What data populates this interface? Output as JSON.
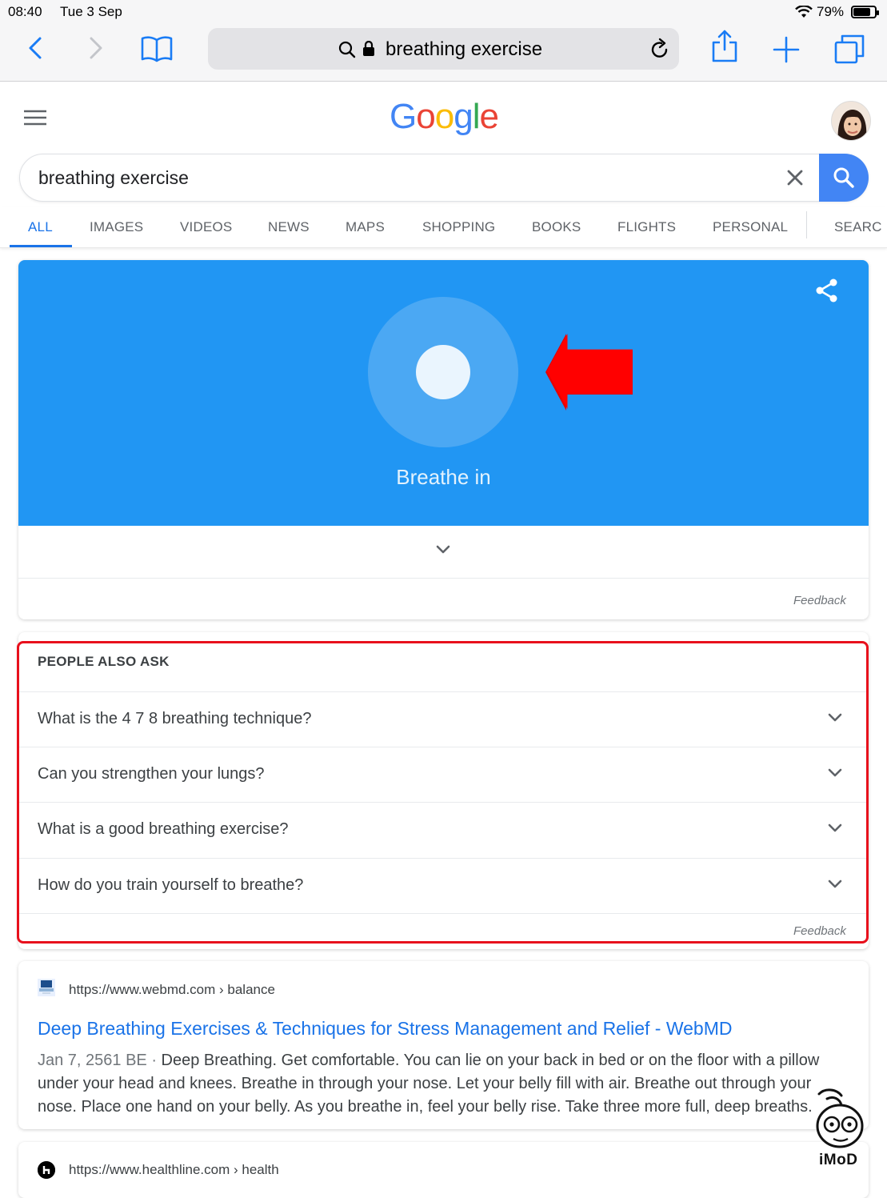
{
  "status_bar": {
    "time": "08:40",
    "date": "Tue 3 Sep",
    "battery_pct": "79%",
    "battery_level": 0.79
  },
  "browser": {
    "url_text": "breathing exercise"
  },
  "google": {
    "logo_letters": [
      "G",
      "o",
      "o",
      "g",
      "l",
      "e"
    ],
    "logo_colors": [
      "#4285f4",
      "#ea4335",
      "#fbbc05",
      "#4285f4",
      "#34a853",
      "#ea4335"
    ],
    "search_query": "breathing exercise"
  },
  "tabs": [
    "ALL",
    "IMAGES",
    "VIDEOS",
    "NEWS",
    "MAPS",
    "SHOPPING",
    "BOOKS",
    "FLIGHTS",
    "PERSONAL",
    "SEARC"
  ],
  "active_tab": "ALL",
  "breathe_widget": {
    "label": "Breathe in",
    "feedback": "Feedback",
    "panel_color": "#2196f3"
  },
  "people_also_ask": {
    "title": "PEOPLE ALSO ASK",
    "questions": [
      "What is the 4 7 8 breathing technique?",
      "Can you strengthen your lungs?",
      "What is a good breathing exercise?",
      "How do you train yourself to breathe?"
    ],
    "feedback": "Feedback"
  },
  "results": [
    {
      "url": "https://www.webmd.com › balance",
      "title": "Deep Breathing Exercises & Techniques for Stress Management and Relief - WebMD",
      "date": "Jan 7, 2561 BE · ",
      "snippet": "Deep Breathing. Get comfortable. You can lie on your back in bed or on the floor with a pillow under your head and knees. Breathe in through your nose. Let your belly fill with air. Breathe out through your nose. Place one hand on your belly. As you breathe in, feel your belly rise. Take three more full, deep breaths."
    },
    {
      "url": "https://www.healthline.com › health"
    }
  ],
  "watermark": {
    "text": "iMoD"
  }
}
